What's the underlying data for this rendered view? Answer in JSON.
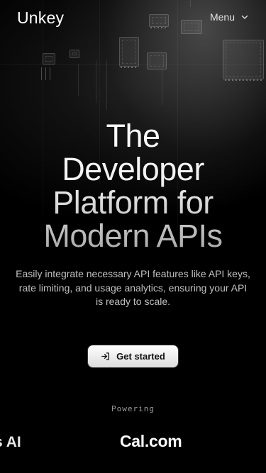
{
  "header": {
    "logo": "Unkey",
    "menu_label": "Menu"
  },
  "hero": {
    "title_lines": [
      "The",
      "Developer",
      "Platform for",
      "Modern APIs"
    ],
    "subtitle": "Easily integrate necessary API features like API keys, rate limiting, and usage analytics, ensuring your API is ready to scale.",
    "cta_label": "Get started"
  },
  "powering": {
    "label": "Powering",
    "logos": [
      "s AI",
      "Cal.com"
    ]
  }
}
